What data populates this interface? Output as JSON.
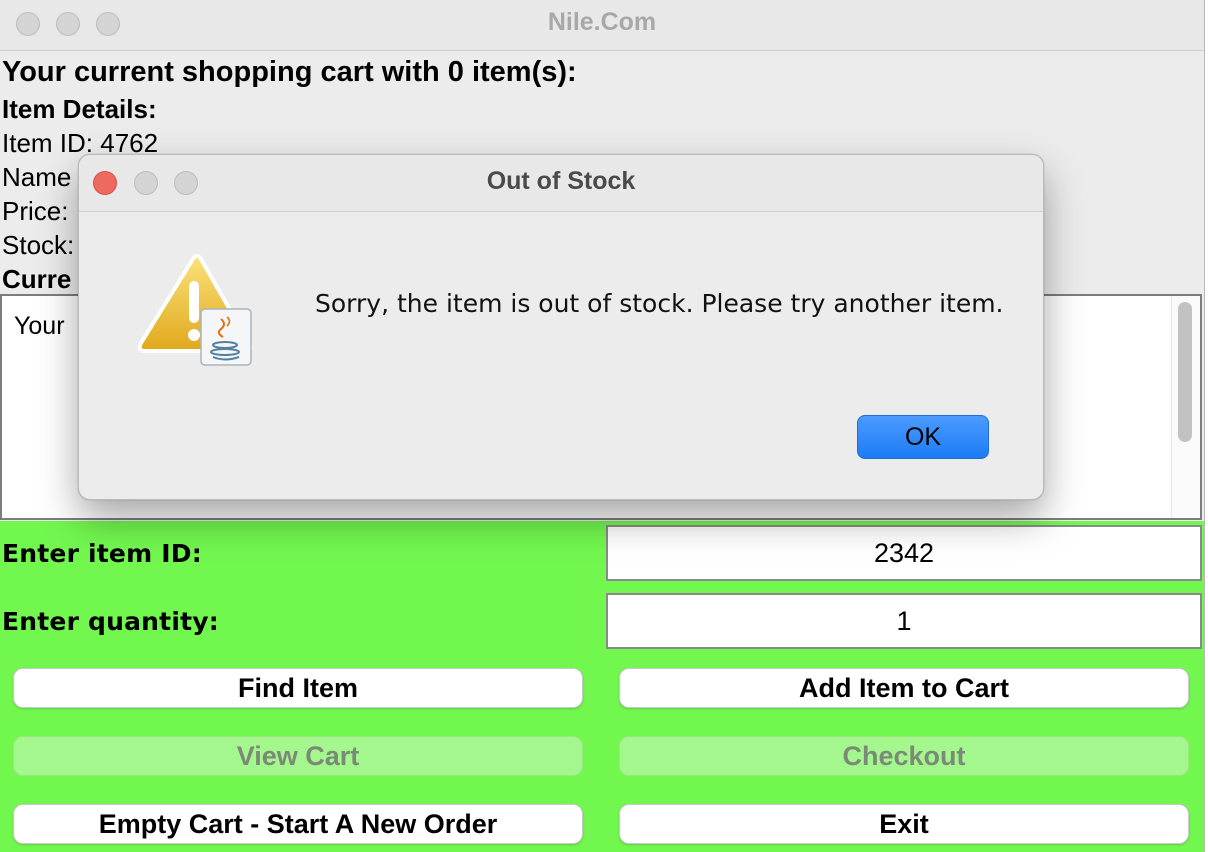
{
  "window": {
    "title": "Nile.Com"
  },
  "cart_header": "Your current shopping cart with 0 item(s):",
  "item_details": {
    "heading": "Item Details:",
    "item_id": "Item ID: 4762",
    "name": "Name",
    "price": "Price:",
    "stock": "Stock:",
    "current": "Curre"
  },
  "cart_area": {
    "text": "Your"
  },
  "form": {
    "item_id_label": "Enter item ID:",
    "item_id_value": "2342",
    "quantity_label": "Enter quantity:",
    "quantity_value": "1"
  },
  "buttons": {
    "find_item": "Find Item",
    "add_item": "Add Item to Cart",
    "view_cart": "View Cart",
    "checkout": "Checkout",
    "empty_cart": "Empty Cart - Start A New Order",
    "exit": "Exit"
  },
  "dialog": {
    "title": "Out of Stock",
    "message": "Sorry, the item is out of stock. Please try another item.",
    "ok_label": "OK",
    "icon": "warning-java-icon"
  },
  "colors": {
    "panel_green": "#72f74f",
    "disabled_button": "#a4f78d",
    "ok_blue": "#1c7cf6",
    "close_red": "#ed6a5e"
  }
}
